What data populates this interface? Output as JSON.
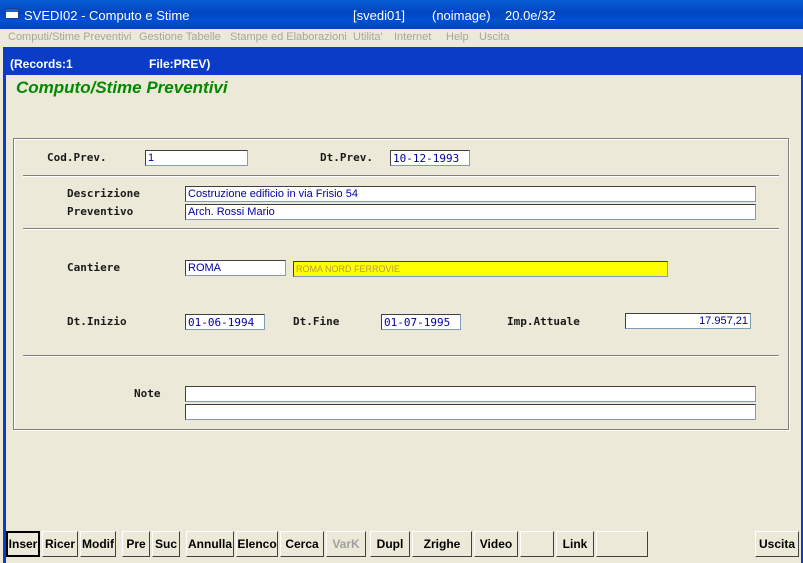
{
  "window": {
    "title": "SVEDI02 - Computo e Stime",
    "instance": "[svedi01]",
    "image_status": "(noimage)",
    "version": "20.0e/32"
  },
  "menu": {
    "items": [
      "Computi/Stime Preventivi",
      "Gestione Tabelle",
      "Stampe ed Elaborazioni",
      "Utilita'",
      "Internet",
      "Help",
      "Uscita"
    ]
  },
  "status": {
    "records": "(Records:1",
    "file": "File:PREV)"
  },
  "form": {
    "title": "Computo/Stime Preventivi",
    "labels": {
      "cod_prev": "Cod.Prev.",
      "dt_prev": "Dt.Prev.",
      "descrizione": "Descrizione",
      "preventivo": "Preventivo",
      "cantiere": "Cantiere",
      "dt_inizio": "Dt.Inizio",
      "dt_fine": "Dt.Fine",
      "imp_attuale": "Imp.Attuale",
      "note": "Note"
    },
    "values": {
      "cod_prev": "1",
      "dt_prev": "10-12-1993",
      "descrizione": "Costruzione edificio in via Frisio 54",
      "preventivo": "Arch. Rossi Mario",
      "cantiere_code": "ROMA",
      "cantiere_desc": "ROMA NORD FERROVIE",
      "dt_inizio": "01-06-1994",
      "dt_fine": "01-07-1995",
      "imp_attuale": "17.957,21",
      "note_1": "",
      "note_2": ""
    }
  },
  "toolbar": {
    "inser": "Inser",
    "ricer": "Ricer",
    "modif": "Modif",
    "pre": "Pre",
    "suc": "Suc",
    "annulla": "Annulla",
    "elenco": "Elenco",
    "cerca": "Cerca",
    "vark": "VarK",
    "dupl": "Dupl",
    "zrighe": "Zrighe",
    "video": "Video",
    "blank1": "",
    "link": "Link",
    "blank2": "",
    "uscita": "Uscita"
  },
  "colors": {
    "title_green": "#008a00",
    "field_text": "#0000a0",
    "highlight_yellow": "#ffff00",
    "frame_blue": "#0a3cc8"
  }
}
